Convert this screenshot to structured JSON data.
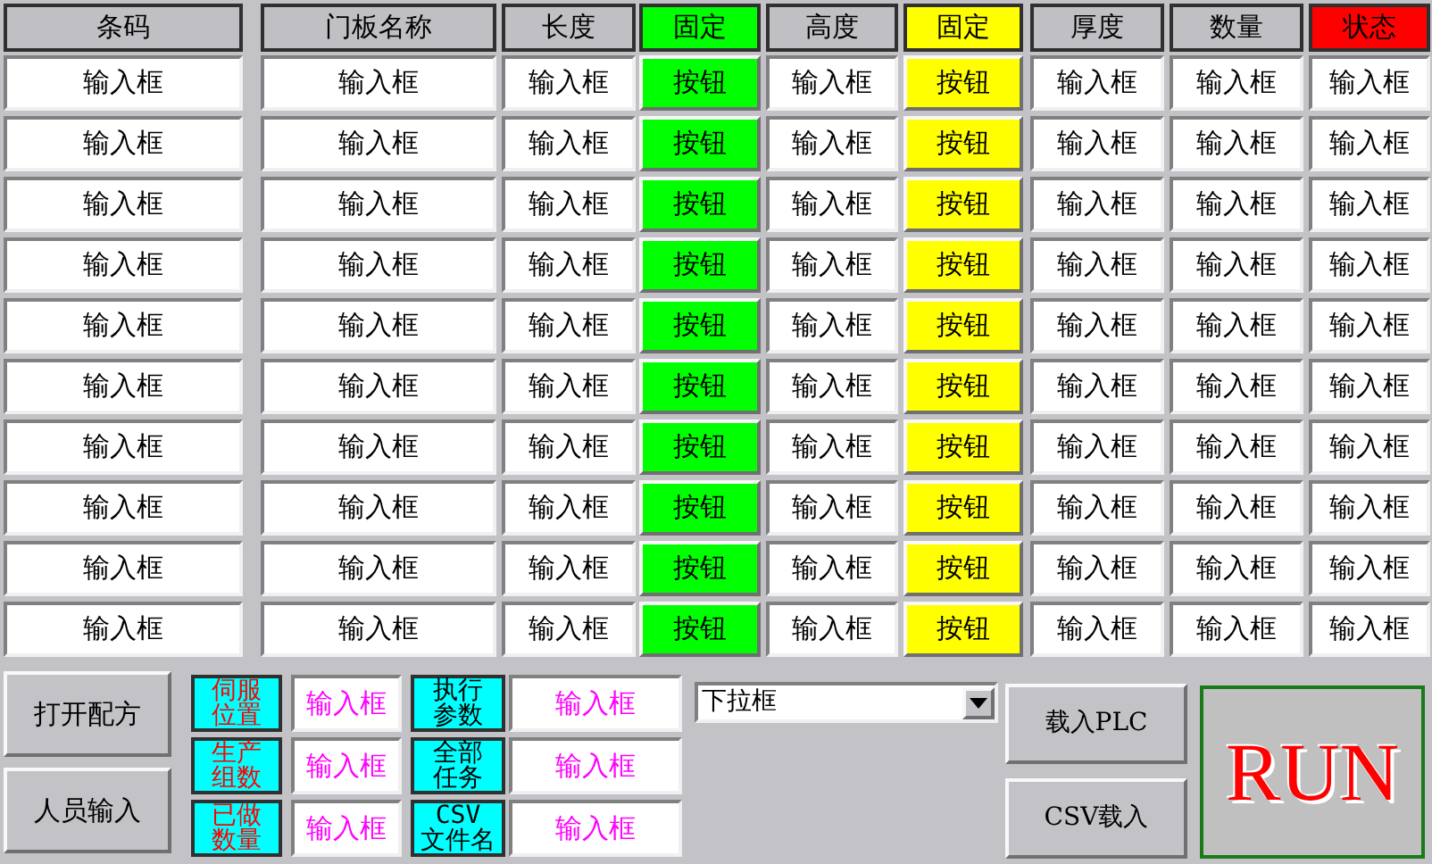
{
  "columns": [
    {
      "label": "条码",
      "kind": "field",
      "color": "#c0bfc4"
    },
    {
      "label": "门板名称",
      "kind": "field",
      "color": "#c0bfc4"
    },
    {
      "label": "长度",
      "kind": "field",
      "color": "#c0bfc4"
    },
    {
      "label": "固定",
      "kind": "button",
      "color": "#00ff00"
    },
    {
      "label": "高度",
      "kind": "field",
      "color": "#c0bfc4"
    },
    {
      "label": "固定",
      "kind": "button",
      "color": "#ffff00"
    },
    {
      "label": "厚度",
      "kind": "field",
      "color": "#c0bfc4"
    },
    {
      "label": "数量",
      "kind": "field",
      "color": "#c0bfc4"
    },
    {
      "label": "状态",
      "kind": "field",
      "color": "#ff0000"
    }
  ],
  "rows": [
    {
      "cells": [
        "输入框",
        "输入框",
        "输入框",
        "按钮",
        "输入框",
        "按钮",
        "输入框",
        "输入框",
        "输入框"
      ]
    },
    {
      "cells": [
        "输入框",
        "输入框",
        "输入框",
        "按钮",
        "输入框",
        "按钮",
        "输入框",
        "输入框",
        "输入框"
      ]
    },
    {
      "cells": [
        "输入框",
        "输入框",
        "输入框",
        "按钮",
        "输入框",
        "按钮",
        "输入框",
        "输入框",
        "输入框"
      ]
    },
    {
      "cells": [
        "输入框",
        "输入框",
        "输入框",
        "按钮",
        "输入框",
        "按钮",
        "输入框",
        "输入框",
        "输入框"
      ]
    },
    {
      "cells": [
        "输入框",
        "输入框",
        "输入框",
        "按钮",
        "输入框",
        "按钮",
        "输入框",
        "输入框",
        "输入框"
      ]
    },
    {
      "cells": [
        "输入框",
        "输入框",
        "输入框",
        "按钮",
        "输入框",
        "按钮",
        "输入框",
        "输入框",
        "输入框"
      ]
    },
    {
      "cells": [
        "输入框",
        "输入框",
        "输入框",
        "按钮",
        "输入框",
        "按钮",
        "输入框",
        "输入框",
        "输入框"
      ]
    },
    {
      "cells": [
        "输入框",
        "输入框",
        "输入框",
        "按钮",
        "输入框",
        "按钮",
        "输入框",
        "输入框",
        "输入框"
      ]
    },
    {
      "cells": [
        "输入框",
        "输入框",
        "输入框",
        "按钮",
        "输入框",
        "按钮",
        "输入框",
        "输入框",
        "输入框"
      ]
    },
    {
      "cells": [
        "输入框",
        "输入框",
        "输入框",
        "按钮",
        "输入框",
        "按钮",
        "输入框",
        "输入框",
        "输入框"
      ]
    }
  ],
  "side_buttons": [
    "打开配方",
    "人员输入"
  ],
  "params_left": [
    {
      "lines": [
        "伺服",
        "位置"
      ],
      "alert": true,
      "value": "输入框"
    },
    {
      "lines": [
        "生产",
        "组数"
      ],
      "alert": true,
      "value": "输入框"
    },
    {
      "lines": [
        "已做",
        "数量"
      ],
      "alert": true,
      "value": "输入框"
    }
  ],
  "params_right": [
    {
      "lines": [
        "执行",
        "参数"
      ],
      "alert": false,
      "value": "输入框"
    },
    {
      "lines": [
        "全部",
        "任务"
      ],
      "alert": false,
      "value": "输入框"
    },
    {
      "lines": [
        "CSV",
        "文件名"
      ],
      "alert": false,
      "value": "输入框"
    }
  ],
  "dropdown": {
    "value": "下拉框"
  },
  "load_buttons": [
    "载入PLC",
    "CSV载入"
  ],
  "run_button": "RUN"
}
